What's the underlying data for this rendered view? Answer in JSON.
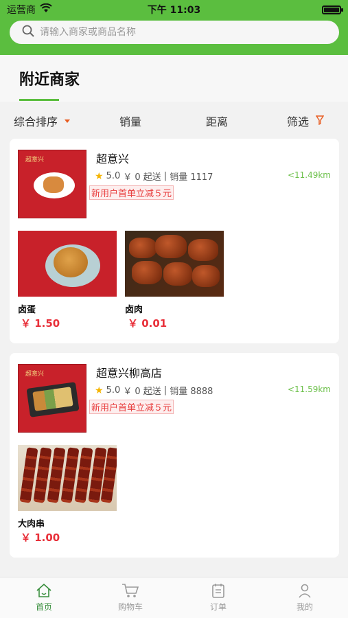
{
  "status": {
    "carrier": "运营商",
    "time": "下午 11:03"
  },
  "search": {
    "placeholder": "请输入商家或商品名称"
  },
  "section": {
    "title": "附近商家"
  },
  "filters": {
    "sort": "综合排序",
    "sales": "销量",
    "distance": "距离",
    "filter": "筛选"
  },
  "shops": [
    {
      "name": "超意兴",
      "rating": "5.0",
      "min_order": "￥ 0 起送",
      "sales": "销量 1117",
      "distance": "<11.49km",
      "promo": "新用户首单立减５元",
      "logo_brand": "超意兴",
      "products": [
        {
          "name": "卤蛋",
          "price": "￥ 1.50"
        },
        {
          "name": "卤肉",
          "price": "￥ 0.01"
        }
      ]
    },
    {
      "name": "超意兴柳高店",
      "rating": "5.0",
      "min_order": "￥ 0 起送",
      "sales": "销量 8888",
      "distance": "<11.59km",
      "promo": "新用户首单立减５元",
      "logo_brand": "超意兴",
      "products": [
        {
          "name": "大肉串",
          "price": "￥ 1.00"
        }
      ]
    }
  ],
  "tabs": [
    {
      "label": "首页",
      "icon": "home-icon"
    },
    {
      "label": "购物车",
      "icon": "cart-icon"
    },
    {
      "label": "订单",
      "icon": "order-icon"
    },
    {
      "label": "我的",
      "icon": "user-icon"
    }
  ],
  "colors": {
    "brand_green": "#5bbe3f",
    "price_red": "#e8303a",
    "distance_green": "#6cc04a"
  }
}
